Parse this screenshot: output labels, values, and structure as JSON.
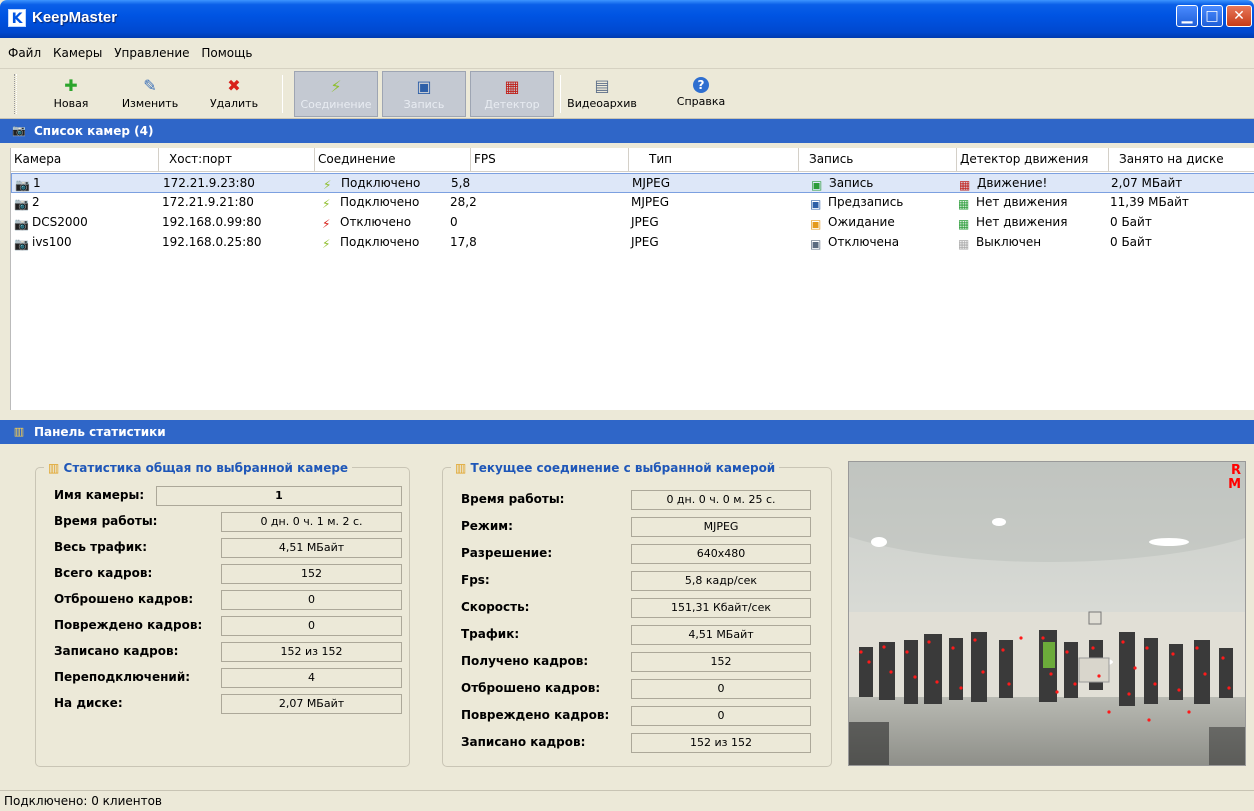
{
  "window": {
    "title": "KeepMaster",
    "app_icon_letter": "K"
  },
  "menu": [
    "Файл",
    "Камеры",
    "Управление",
    "Помощь"
  ],
  "toolbar": {
    "new": "Новая",
    "edit": "Изменить",
    "delete": "Удалить",
    "connection": "Соединение",
    "record": "Запись",
    "detector": "Детектор",
    "archive": "Видеоархив",
    "help": "Справка"
  },
  "camera_list": {
    "title": "Список камер (4)",
    "columns": [
      "Камера",
      "Хост:порт",
      "Соединение",
      "FPS",
      "Тип",
      "Запись",
      "Детектор движения",
      "Занято на диске"
    ],
    "rows": [
      {
        "name": "1",
        "host": "172.21.9.23:80",
        "conn": "Подключено",
        "fps": "5,8",
        "type": "MJPEG",
        "rec": "Запись",
        "det": "Движение!",
        "disk": "2,07 МБайт"
      },
      {
        "name": "2",
        "host": "172.21.9.21:80",
        "conn": "Подключено",
        "fps": "28,2",
        "type": "MJPEG",
        "rec": "Предзапись",
        "det": "Нет движения",
        "disk": "11,39 МБайт"
      },
      {
        "name": "DCS2000",
        "host": "192.168.0.99:80",
        "conn": "Отключено",
        "fps": "0",
        "type": "JPEG",
        "rec": "Ожидание",
        "det": "Нет движения",
        "disk": "0 Байт"
      },
      {
        "name": "ivs100",
        "host": "192.168.0.25:80",
        "conn": "Подключено",
        "fps": "17,8",
        "type": "JPEG",
        "rec": "Отключена",
        "det": "Выключен",
        "disk": "0 Байт"
      }
    ]
  },
  "stats_panel": {
    "title": "Панель статистики",
    "general": {
      "title": "Статистика общая по выбранной камере",
      "rows": [
        {
          "label": "Имя камеры:",
          "value": "1"
        },
        {
          "label": "Время работы:",
          "value": "0 дн. 0 ч. 1 м. 2 с."
        },
        {
          "label": "Весь трафик:",
          "value": "4,51 МБайт"
        },
        {
          "label": "Всего кадров:",
          "value": "152"
        },
        {
          "label": "Отброшено кадров:",
          "value": "0"
        },
        {
          "label": "Повреждено кадров:",
          "value": "0"
        },
        {
          "label": "Записано кадров:",
          "value": "152 из 152"
        },
        {
          "label": "Переподключений:",
          "value": "4"
        },
        {
          "label": "На диске:",
          "value": "2,07 МБайт"
        }
      ]
    },
    "current": {
      "title": "Текущее соединение с выбранной камерой",
      "rows": [
        {
          "label": "Время работы:",
          "value": "0 дн. 0 ч. 0 м. 25 с."
        },
        {
          "label": "Режим:",
          "value": "MJPEG"
        },
        {
          "label": "Разрешение:",
          "value": "640x480"
        },
        {
          "label": "Fps:",
          "value": "5,8 кадр/сек"
        },
        {
          "label": "Скорость:",
          "value": "151,31 Кбайт/сек"
        },
        {
          "label": "Трафик:",
          "value": "4,51 МБайт"
        },
        {
          "label": "Получено кадров:",
          "value": "152"
        },
        {
          "label": "Отброшено кадров:",
          "value": "0"
        },
        {
          "label": "Повреждено кадров:",
          "value": "0"
        },
        {
          "label": "Записано кадров:",
          "value": "152 из 152"
        }
      ]
    },
    "image_overlay": {
      "line1": "R",
      "line2": "M"
    }
  },
  "status": "Подключено: 0 клиентов",
  "colors": {
    "title_blue": "#0054e3",
    "panel_blue": "#2f66c8",
    "group_title": "#1f57b8",
    "overlay_red": "#ff0000"
  }
}
